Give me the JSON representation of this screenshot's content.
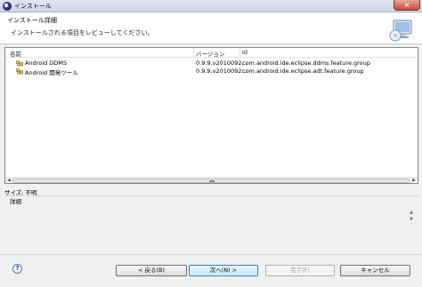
{
  "window": {
    "title": "インストール",
    "close_glyph": "×"
  },
  "header": {
    "title": "インストール詳細",
    "description": "インストールされる項目をレビューしてください。",
    "icon": "install-wizard-icon"
  },
  "table": {
    "columns": [
      "名前",
      "バージョン",
      "Id"
    ],
    "rows": [
      {
        "name": "Android DDMS",
        "version": "0.9.9.v2010092...",
        "id": "com.android.ide.eclipse.ddms.feature.group",
        "icon": "feature-package-icon"
      },
      {
        "name": "Android 開発ツール",
        "version": "0.9.9.v2010092...",
        "id": "com.android.ide.eclipse.adt.feature.group",
        "icon": "feature-package-icon"
      }
    ]
  },
  "size_label": "サイズ: 不明",
  "details_label": "詳細",
  "buttons": {
    "help": "?",
    "back": "< 戻る(B)",
    "next": "次へ(N) >",
    "finish": "完了(F)",
    "cancel": "キャンセル"
  }
}
